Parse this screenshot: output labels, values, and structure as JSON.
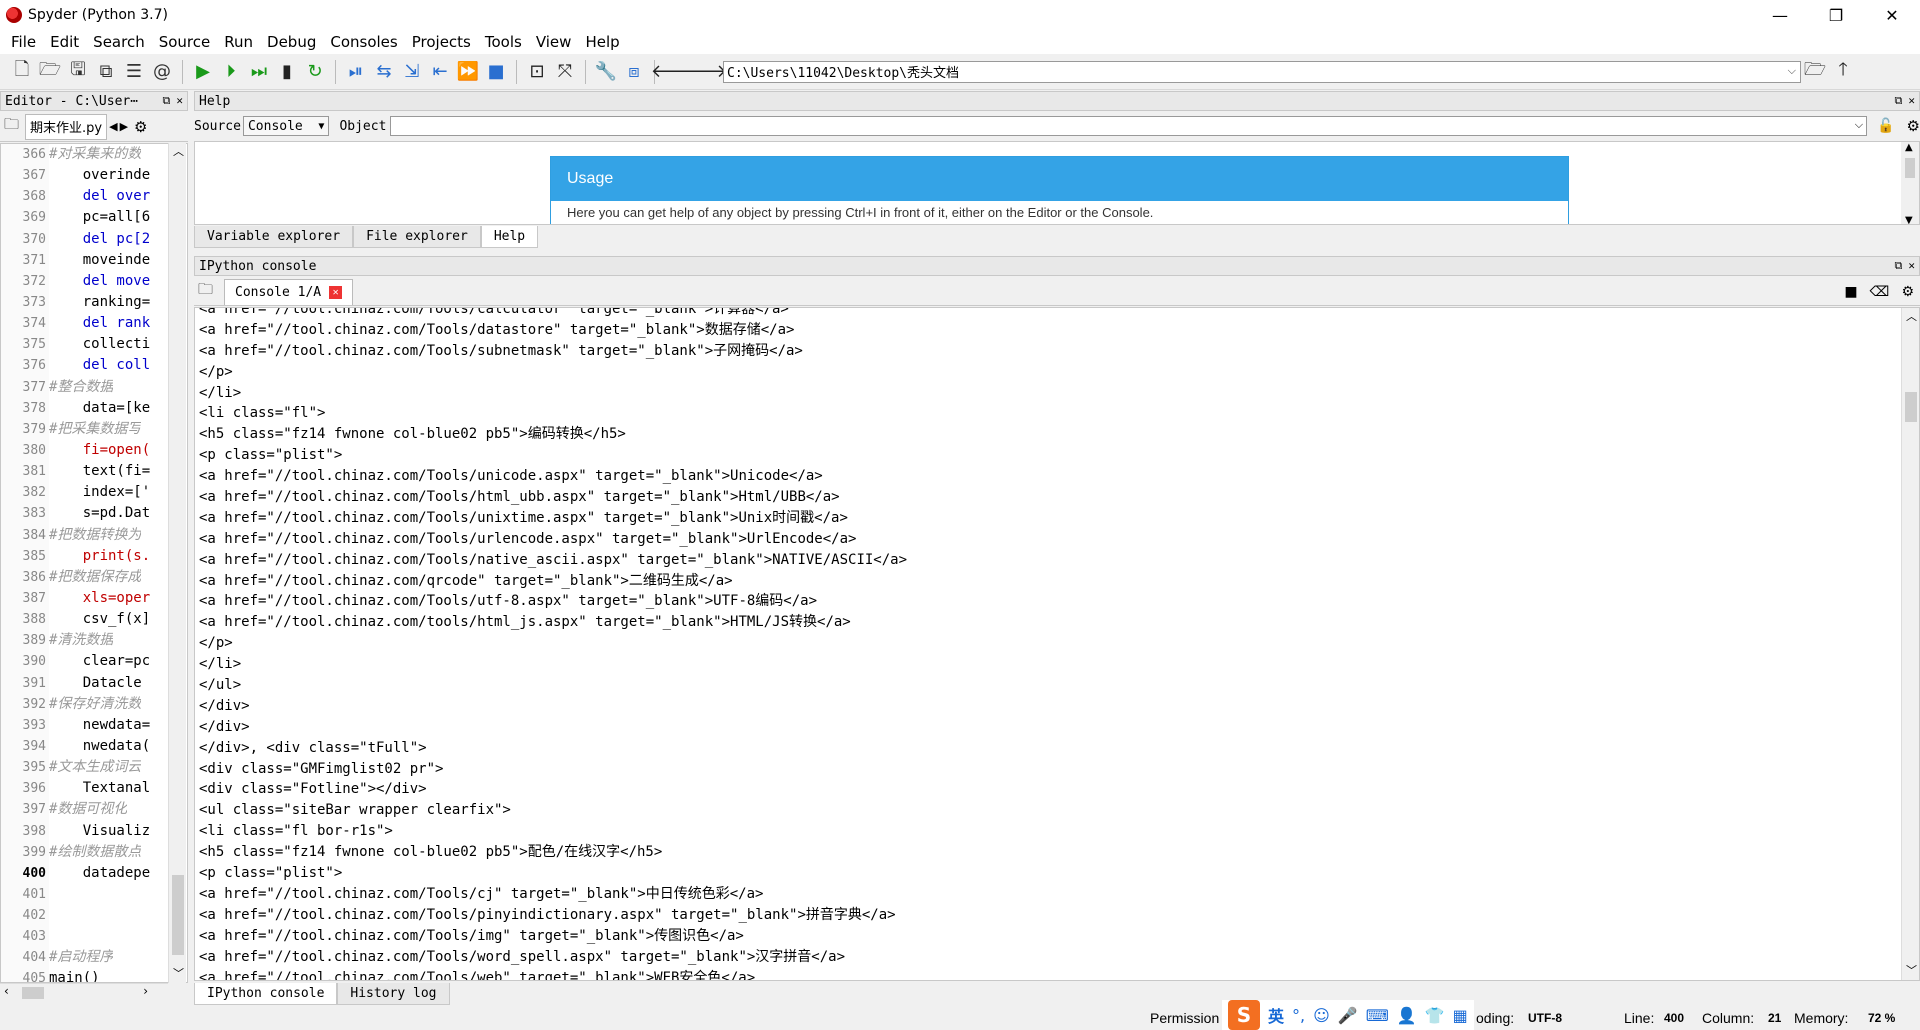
{
  "window": {
    "title": "Spyder (Python 3.7)",
    "minimize": "—",
    "restore": "❐",
    "close": "✕"
  },
  "menu": [
    "File",
    "Edit",
    "Search",
    "Source",
    "Run",
    "Debug",
    "Consoles",
    "Projects",
    "Tools",
    "View",
    "Help"
  ],
  "toolbar": {
    "path": "C:\\Users\\11042\\Desktop\\秃头文档"
  },
  "editor": {
    "header": "Editor - C:\\User⋯",
    "tab": "期末作业.py",
    "lines": [
      {
        "n": "366",
        "t": "#对采集来的数",
        "c": "cmt"
      },
      {
        "n": "367",
        "t": "    overinde",
        "c": ""
      },
      {
        "n": "368",
        "t": "    del over",
        "c": "kw"
      },
      {
        "n": "369",
        "t": "    pc=all[6",
        "c": ""
      },
      {
        "n": "370",
        "t": "    del pc[2",
        "c": "kw"
      },
      {
        "n": "371",
        "t": "    moveinde",
        "c": ""
      },
      {
        "n": "372",
        "t": "    del move",
        "c": "kw"
      },
      {
        "n": "373",
        "t": "    ranking=",
        "c": ""
      },
      {
        "n": "374",
        "t": "    del rank",
        "c": "kw"
      },
      {
        "n": "375",
        "t": "    collecti",
        "c": ""
      },
      {
        "n": "376",
        "t": "    del coll",
        "c": "kw"
      },
      {
        "n": "377",
        "t": "#整合数据",
        "c": "cmt"
      },
      {
        "n": "378",
        "t": "    data=[ke",
        "c": ""
      },
      {
        "n": "379",
        "t": "#把采集数据写",
        "c": "cmt"
      },
      {
        "n": "380",
        "t": "    fi=open(",
        "c": "fn"
      },
      {
        "n": "381",
        "t": "    text(fi=",
        "c": ""
      },
      {
        "n": "382",
        "t": "    index=['",
        "c": ""
      },
      {
        "n": "383",
        "t": "    s=pd.Dat",
        "c": ""
      },
      {
        "n": "384",
        "t": "#把数据转换为",
        "c": "cmt"
      },
      {
        "n": "385",
        "t": "    print(s.",
        "c": "fn"
      },
      {
        "n": "386",
        "t": "#把数据保存成",
        "c": "cmt"
      },
      {
        "n": "387",
        "t": "    xls=oper",
        "c": "fn"
      },
      {
        "n": "388",
        "t": "    csv_f(x]",
        "c": ""
      },
      {
        "n": "389",
        "t": "#清洗数据",
        "c": "cmt"
      },
      {
        "n": "390",
        "t": "    clear=pc",
        "c": ""
      },
      {
        "n": "391",
        "t": "    Datacle",
        "c": ""
      },
      {
        "n": "392",
        "t": "#保存好清洗数",
        "c": "cmt"
      },
      {
        "n": "393",
        "t": "    newdata=",
        "c": ""
      },
      {
        "n": "394",
        "t": "    nwedata(",
        "c": ""
      },
      {
        "n": "395",
        "t": "#文本生成词云",
        "c": "cmt"
      },
      {
        "n": "396",
        "t": "    Textanal",
        "c": ""
      },
      {
        "n": "397",
        "t": "#数据可视化",
        "c": "cmt"
      },
      {
        "n": "398",
        "t": "    Visualiz",
        "c": ""
      },
      {
        "n": "399",
        "t": "#绘制数据散点",
        "c": "cmt"
      },
      {
        "n": "400",
        "t": "    datadepe",
        "c": "cur"
      },
      {
        "n": "401",
        "t": "",
        "c": ""
      },
      {
        "n": "402",
        "t": "",
        "c": ""
      },
      {
        "n": "403",
        "t": "",
        "c": ""
      },
      {
        "n": "404",
        "t": "#启动程序",
        "c": "cmt"
      },
      {
        "n": "405",
        "t": "main()",
        "c": ""
      }
    ]
  },
  "help": {
    "header": "Help",
    "source_label": "Source",
    "source_value": "Console",
    "object_label": "Object",
    "usage_title": "Usage",
    "usage_text": "Here you can get help of any object by pressing Ctrl+I in front of it, either on the Editor or the Console.",
    "tabs": [
      "Variable explorer",
      "File explorer",
      "Help"
    ]
  },
  "console": {
    "header": "IPython console",
    "tab": "Console 1/A",
    "lines": [
      "<a href=\"//tool.chinaz.com/Tools/calculator\" target=\"_blank\">计算器</a>",
      "<a href=\"//tool.chinaz.com/Tools/datastore\" target=\"_blank\">数据存储</a>",
      "<a href=\"//tool.chinaz.com/Tools/subnetmask\" target=\"_blank\">子网掩码</a>",
      "</p>",
      "</li>",
      "<li class=\"fl\">",
      "<h5 class=\"fz14 fwnone col-blue02 pb5\">编码转换</h5>",
      "<p class=\"plist\">",
      "<a href=\"//tool.chinaz.com/Tools/unicode.aspx\" target=\"_blank\">Unicode</a>",
      "<a href=\"//tool.chinaz.com/Tools/html_ubb.aspx\" target=\"_blank\">Html/UBB</a>",
      "<a href=\"//tool.chinaz.com/Tools/unixtime.aspx\" target=\"_blank\">Unix时间戳</a>",
      "<a href=\"//tool.chinaz.com/Tools/urlencode.aspx\" target=\"_blank\">UrlEncode</a>",
      "<a href=\"//tool.chinaz.com/Tools/native_ascii.aspx\" target=\"_blank\">NATIVE/ASCII</a>",
      "<a href=\"//tool.chinaz.com/qrcode\" target=\"_blank\">二维码生成</a>",
      "<a href=\"//tool.chinaz.com/Tools/utf-8.aspx\" target=\"_blank\">UTF-8编码</a>",
      "<a href=\"//tool.chinaz.com/tools/html_js.aspx\" target=\"_blank\">HTML/JS转换</a>",
      "</p>",
      "</li>",
      "</ul>",
      "</div>",
      "</div>",
      "</div>, <div class=\"tFull\">",
      "<div class=\"GMFimglist02 pr\">",
      "<div class=\"Fotline\"></div>",
      "<ul class=\"siteBar wrapper clearfix\">",
      "<li class=\"fl bor-r1s\">",
      "<h5 class=\"fz14 fwnone col-blue02 pb5\">配色/在线汉字</h5>",
      "<p class=\"plist\">",
      "<a href=\"//tool.chinaz.com/Tools/cj\" target=\"_blank\">中日传统色彩</a>",
      "<a href=\"//tool.chinaz.com/Tools/pinyindictionary.aspx\" target=\"_blank\">拼音字典</a>",
      "<a href=\"//tool.chinaz.com/Tools/img\" target=\"_blank\">传图识色</a>",
      "<a href=\"//tool.chinaz.com/Tools/word_spell.aspx\" target=\"_blank\">汉字拼音</a>",
      "<a href=\"//tool.chinaz.com/Tools/web\" target=\"_blank\">WEB安全色</a>"
    ],
    "bottom_tabs": [
      "IPython console",
      "History log"
    ]
  },
  "status": {
    "permissions": "Permission",
    "encoding_label": "oding:",
    "encoding": "UTF-8",
    "line_label": "Line:",
    "line": "400",
    "column_label": "Column:",
    "column": "21",
    "memory_label": "Memory:",
    "memory": "72 %"
  },
  "ime": {
    "logo": "S",
    "mode": "英"
  }
}
